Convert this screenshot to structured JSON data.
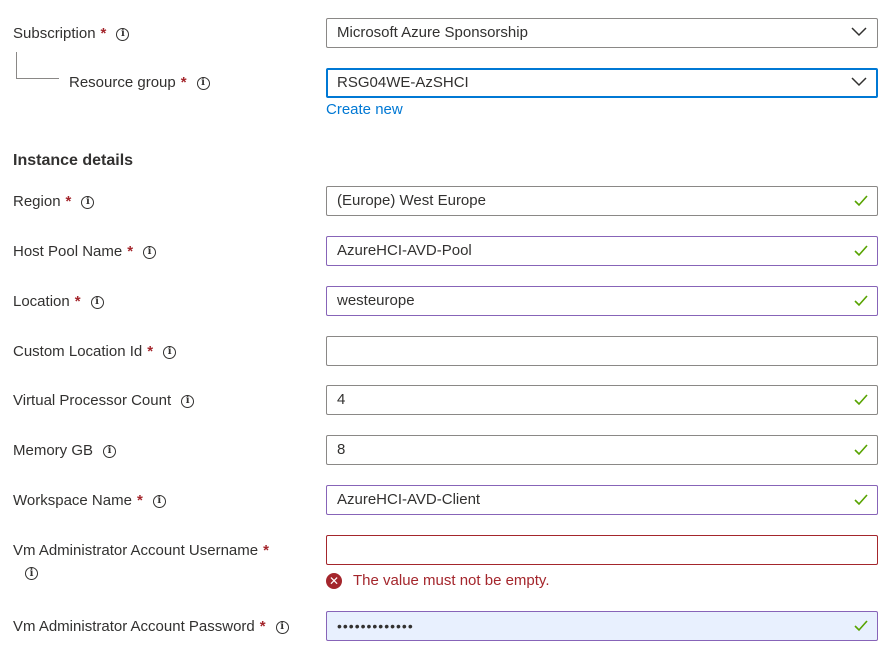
{
  "subscription": {
    "label": "Subscription",
    "required": "*",
    "value": "Microsoft Azure Sponsorship"
  },
  "resource_group": {
    "label": "Resource group",
    "required": "*",
    "value": "RSG04WE-AzSHCI",
    "create_new": "Create new"
  },
  "instance_details": {
    "heading": "Instance details"
  },
  "region": {
    "label": "Region",
    "required": "*",
    "value": "(Europe) West Europe"
  },
  "host_pool_name": {
    "label": "Host Pool Name",
    "required": "*",
    "value": "AzureHCI-AVD-Pool"
  },
  "location": {
    "label": "Location",
    "required": "*",
    "value": "westeurope"
  },
  "custom_location_id": {
    "label": "Custom Location Id",
    "required": "*",
    "value": ""
  },
  "virtual_processor_count": {
    "label": "Virtual Processor Count",
    "value": "4"
  },
  "memory_gb": {
    "label": "Memory GB",
    "value": "8"
  },
  "workspace_name": {
    "label": "Workspace Name",
    "required": "*",
    "value": "AzureHCI-AVD-Client"
  },
  "vm_admin_username": {
    "label": "Vm Administrator Account Username",
    "required": "*",
    "value": "",
    "error": "The value must not be empty."
  },
  "vm_admin_password": {
    "label": "Vm Administrator Account Password",
    "required": "*",
    "value": "•••••••••••••"
  },
  "icons": {
    "info": "info-icon",
    "check": "checkmark-icon",
    "chevron": "chevron-down-icon",
    "error": "error-icon"
  },
  "colors": {
    "accent": "#0078d4",
    "valid_check": "#57a300",
    "error": "#a4262c",
    "valid_border": "#8764b8"
  }
}
